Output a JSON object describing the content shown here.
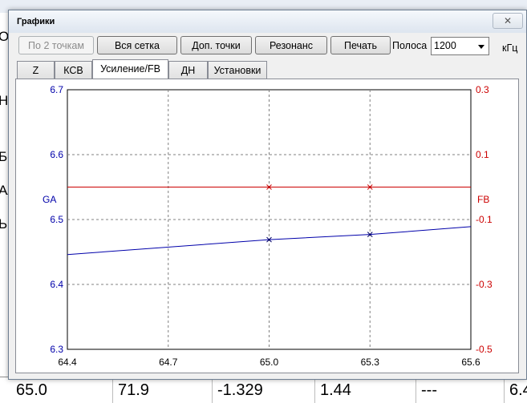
{
  "background": {
    "left_fragments": [
      "Оп",
      "На",
      "Бс",
      "Ал",
      "Ы"
    ],
    "table_row": [
      "65.0",
      "71.9",
      "-1.329",
      "1.44",
      "---",
      "6.4"
    ]
  },
  "window": {
    "title": "Графики",
    "close_glyph": "✕"
  },
  "toolbar": {
    "buttons": [
      "По 2 точкам",
      "Вся сетка",
      "Доп. точки",
      "Резонанс",
      "Печать"
    ],
    "band_label": "Полоса",
    "band_value": "1200",
    "unit_label": "кГц"
  },
  "tabs": [
    "Z",
    "КСВ",
    "Усиление/FB",
    "ДН",
    "Установки"
  ],
  "active_tab": "Усиление/FB",
  "colors": {
    "ga": "#0000aa",
    "fb": "#cc0000",
    "grid": "#808080"
  },
  "chart_data": {
    "type": "line",
    "x_ticks": [
      "64.4",
      "64.7",
      "65.0",
      "65.3",
      "65.6"
    ],
    "xlim": [
      64.4,
      65.6
    ],
    "left_axis": {
      "label": "GA",
      "ticks": [
        "6.7",
        "6.6",
        "6.5",
        "6.4",
        "6.3"
      ],
      "ylim": [
        6.3,
        6.7
      ]
    },
    "right_axis": {
      "label": "FB",
      "ticks": [
        "0.3",
        "0.1",
        "-0.1",
        "-0.3",
        "-0.5"
      ],
      "ylim": [
        -0.5,
        0.3
      ]
    },
    "series": [
      {
        "name": "GA",
        "axis": "left",
        "x": [
          64.4,
          65.0,
          65.3,
          65.6
        ],
        "y": [
          6.446,
          6.469,
          6.477,
          6.489
        ],
        "markers_x": [
          65.0,
          65.3
        ]
      },
      {
        "name": "FB",
        "axis": "right",
        "x": [
          64.4,
          65.6
        ],
        "y": [
          0.0,
          0.0
        ],
        "markers_x": [
          65.0,
          65.3
        ]
      }
    ],
    "grid": true
  }
}
